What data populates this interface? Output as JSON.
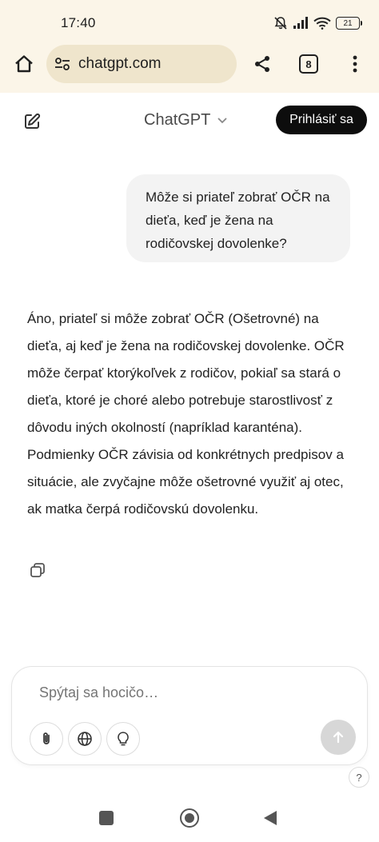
{
  "status_bar": {
    "time": "17:40",
    "battery": "21"
  },
  "browser": {
    "url": "chatgpt.com",
    "tab_count": "8",
    "icons": [
      "home-icon",
      "site-settings-icon",
      "share-icon",
      "more-vert-icon"
    ]
  },
  "app": {
    "model_name": "ChatGPT",
    "login_label": "Prihlásiť sa"
  },
  "conversation": {
    "user_message": "Môže si priateľ zobrať OČR na dieťa, keď je žena na rodičovskej dovolenke?",
    "assistant_message": "Áno, priateľ si môže zobrať OČR (Ošetrovné) na dieťa, aj keď je žena na rodičovskej dovolenke. OČR môže čerpať ktorýkoľvek z rodičov, pokiaľ sa stará o dieťa, ktoré je choré alebo potrebuje starostlivosť z dôvodu iných okolností (napríklad karanténa). Podmienky OČR závisia od konkrétnych predpisov a situácie, ale zvyčajne môže ošetrovné využiť aj otec, ak matka čerpá rodičovskú dovolenku."
  },
  "composer": {
    "placeholder": "Spýtaj sa hocičo…",
    "value": ""
  },
  "help_label": "?"
}
